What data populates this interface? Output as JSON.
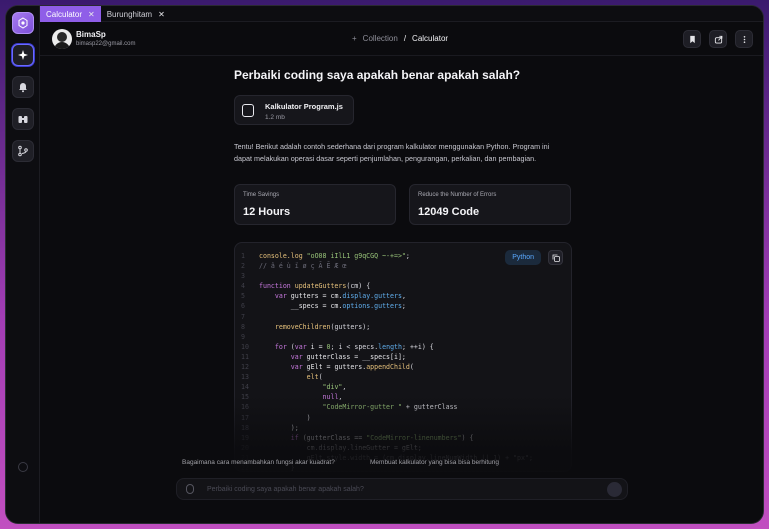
{
  "tabs": [
    {
      "label": "Calculator",
      "active": true
    },
    {
      "label": "Burunghitam",
      "active": false
    }
  ],
  "user": {
    "name": "BimaSp",
    "email": "bimasp22@gmail.com"
  },
  "breadcrumb": {
    "parent": "Collection",
    "separator": "/",
    "current": "Calculator"
  },
  "chat": {
    "question": "Perbaiki coding saya apakah benar apakah salah?",
    "file": {
      "name": "Kalkulator Program.js",
      "size": "1.2 mb"
    },
    "answer": "Tentu! Berikut adalah contoh sederhana dari program kalkulator menggunakan Python. Program ini dapat melakukan operasi dasar seperti penjumlahan, pengurangan, perkalian, dan pembagian.",
    "stats": [
      {
        "label": "Time Savings",
        "value": "12 Hours"
      },
      {
        "label": "Reduce the Number of Errors",
        "value": "12049 Code"
      }
    ],
    "code_language": "Python",
    "code_lines": [
      [
        [
          "fn",
          "console.log "
        ],
        [
          "st",
          "\"oO08 iIlL1 g9qCGQ ~-+=>\""
        ],
        [
          "pl",
          ";"
        ]
      ],
      [
        [
          "cm",
          "// â é ù ï ø ç Ã Ē Æ œ"
        ]
      ],
      [
        [
          "pl",
          ""
        ]
      ],
      [
        [
          "kw",
          "function "
        ],
        [
          "fn",
          "updateGutters"
        ],
        [
          "pl",
          "(cm) {"
        ]
      ],
      [
        [
          "pl",
          "    "
        ],
        [
          "kw",
          "var "
        ],
        [
          "vr",
          "gutters = cm."
        ],
        [
          "at",
          "display.gutters"
        ],
        [
          "pl",
          ","
        ]
      ],
      [
        [
          "pl",
          "        "
        ],
        [
          "vr",
          "__specs = cm."
        ],
        [
          "at",
          "options.gutters"
        ],
        [
          "pl",
          ";"
        ]
      ],
      [
        [
          "pl",
          ""
        ]
      ],
      [
        [
          "pl",
          "    "
        ],
        [
          "fn",
          "removeChildren"
        ],
        [
          "pl",
          "(gutters);"
        ]
      ],
      [
        [
          "pl",
          ""
        ]
      ],
      [
        [
          "pl",
          "    "
        ],
        [
          "kw",
          "for "
        ],
        [
          "pl",
          "("
        ],
        [
          "kw",
          "var "
        ],
        [
          "vr",
          "i = "
        ],
        [
          "st",
          "0"
        ],
        [
          "pl",
          "; i < specs."
        ],
        [
          "at",
          "length"
        ],
        [
          "pl",
          "; ++i) {"
        ]
      ],
      [
        [
          "pl",
          "        "
        ],
        [
          "kw",
          "var "
        ],
        [
          "vr",
          "gutterClass = __specs[i];"
        ]
      ],
      [
        [
          "pl",
          "        "
        ],
        [
          "kw",
          "var "
        ],
        [
          "vr",
          "gElt = gutters."
        ],
        [
          "fn",
          "appendChild"
        ],
        [
          "pl",
          "("
        ]
      ],
      [
        [
          "pl",
          "            "
        ],
        [
          "fn",
          "elt"
        ],
        [
          "pl",
          "("
        ]
      ],
      [
        [
          "pl",
          "                "
        ],
        [
          "st",
          "\"div\""
        ],
        [
          "pl",
          ","
        ]
      ],
      [
        [
          "pl",
          "                "
        ],
        [
          "kw",
          "null"
        ],
        [
          "pl",
          ","
        ]
      ],
      [
        [
          "pl",
          "                "
        ],
        [
          "st",
          "\"CodeMirror-gutter \""
        ],
        [
          "pl",
          " + gutterClass"
        ]
      ],
      [
        [
          "pl",
          "            )"
        ]
      ],
      [
        [
          "pl",
          "        );"
        ]
      ],
      [
        [
          "pl",
          "        "
        ],
        [
          "kw",
          "if "
        ],
        [
          "pl",
          "(gutterClass == "
        ],
        [
          "st",
          "\"CodeMirror-linenumbers\""
        ],
        [
          "pl",
          ") {"
        ]
      ],
      [
        [
          "pl",
          "            cm.display.lineGutter = gElt;"
        ]
      ],
      [
        [
          "pl",
          "            gElt.style.width = (cm.display.lineNumWidth || 1) + \"px\";"
        ]
      ],
      [
        [
          "pl",
          "        }"
        ]
      ]
    ],
    "suggestions": [
      "Bagaimana cara menambahkan fungsi akar kuadrat?",
      "Membuat kalkulator yang bisa bisa berhitung"
    ],
    "input_placeholder": "Perbaiki coding saya apakah benar apakah salah?"
  },
  "icons": {
    "sidebar": [
      "logo-icon",
      "sparkle-icon",
      "bell-icon",
      "binoculars-icon",
      "branch-icon"
    ],
    "header": [
      "bookmark-icon",
      "share-icon",
      "more-icon"
    ]
  }
}
